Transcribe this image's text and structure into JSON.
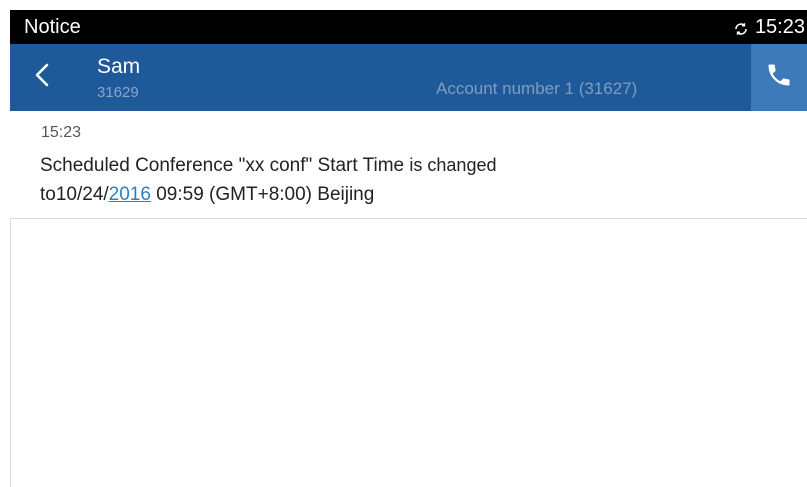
{
  "status_bar": {
    "title": "Notice",
    "time": "15:23",
    "sync_icon": "sync-icon"
  },
  "header": {
    "back_icon": "chevron-left-icon",
    "contact_name": "Sam",
    "contact_number": "31629",
    "account": "Account number 1 (31627)",
    "call_icon": "phone-icon"
  },
  "message": {
    "time": "15:23",
    "text_part1": "Scheduled Conference \"xx conf\" Start Time",
    "text_part2": "is changed",
    "text_part3": "to10/24/",
    "link_text": "2016",
    "text_part4": " 09:59 (GMT+8:00) Beijing"
  },
  "colors": {
    "status_bar": "#000000",
    "header": "#1e5a99",
    "call_button": "#3d7ab9",
    "link": "#2b7fc8"
  }
}
